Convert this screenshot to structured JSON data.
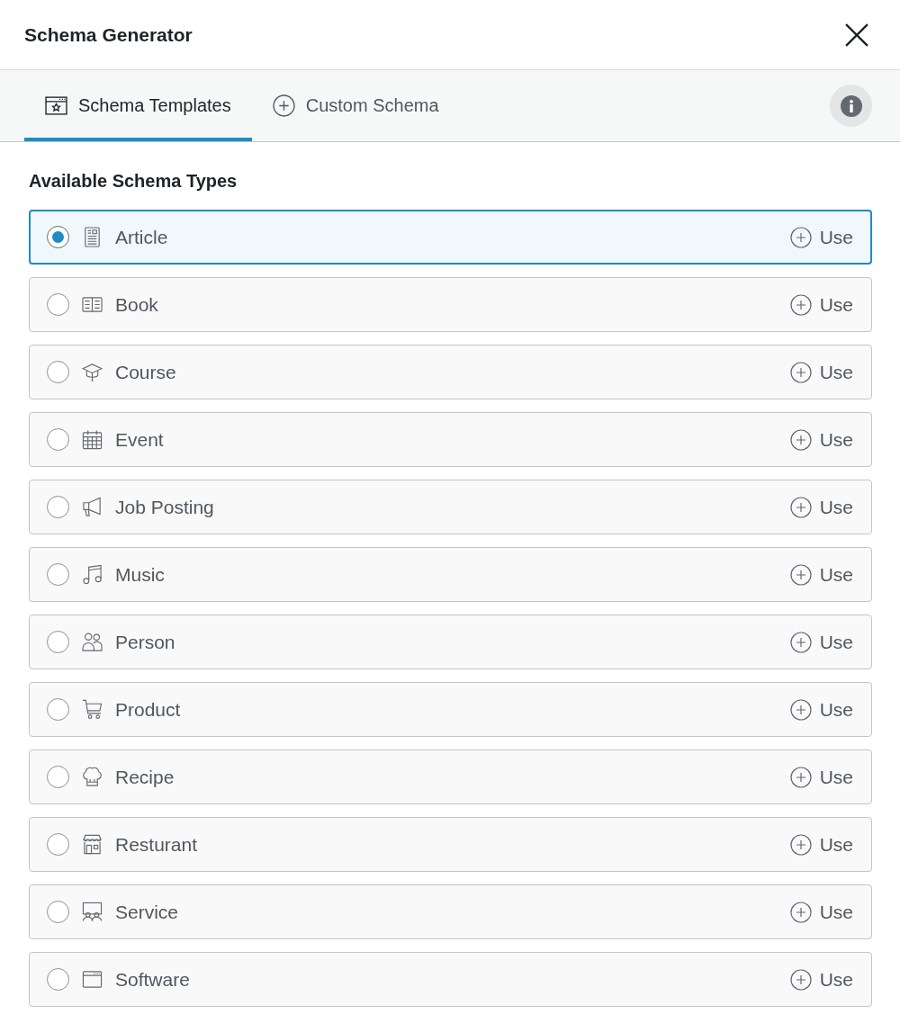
{
  "dialog": {
    "title": "Schema Generator"
  },
  "tabs": [
    {
      "label": "Schema Templates",
      "kind": "templates",
      "selected": true
    },
    {
      "label": "Custom Schema",
      "kind": "custom",
      "selected": false
    }
  ],
  "section": {
    "heading": "Available Schema Types"
  },
  "schema_types": [
    {
      "label": "Article",
      "kind": "article",
      "selected": true,
      "action": "Use"
    },
    {
      "label": "Book",
      "kind": "book",
      "selected": false,
      "action": "Use"
    },
    {
      "label": "Course",
      "kind": "course",
      "selected": false,
      "action": "Use"
    },
    {
      "label": "Event",
      "kind": "event",
      "selected": false,
      "action": "Use"
    },
    {
      "label": "Job Posting",
      "kind": "job",
      "selected": false,
      "action": "Use"
    },
    {
      "label": "Music",
      "kind": "music",
      "selected": false,
      "action": "Use"
    },
    {
      "label": "Person",
      "kind": "person",
      "selected": false,
      "action": "Use"
    },
    {
      "label": "Product",
      "kind": "product",
      "selected": false,
      "action": "Use"
    },
    {
      "label": "Recipe",
      "kind": "recipe",
      "selected": false,
      "action": "Use"
    },
    {
      "label": "Resturant",
      "kind": "restaurant",
      "selected": false,
      "action": "Use"
    },
    {
      "label": "Service",
      "kind": "service",
      "selected": false,
      "action": "Use"
    },
    {
      "label": "Software",
      "kind": "software",
      "selected": false,
      "action": "Use"
    }
  ]
}
